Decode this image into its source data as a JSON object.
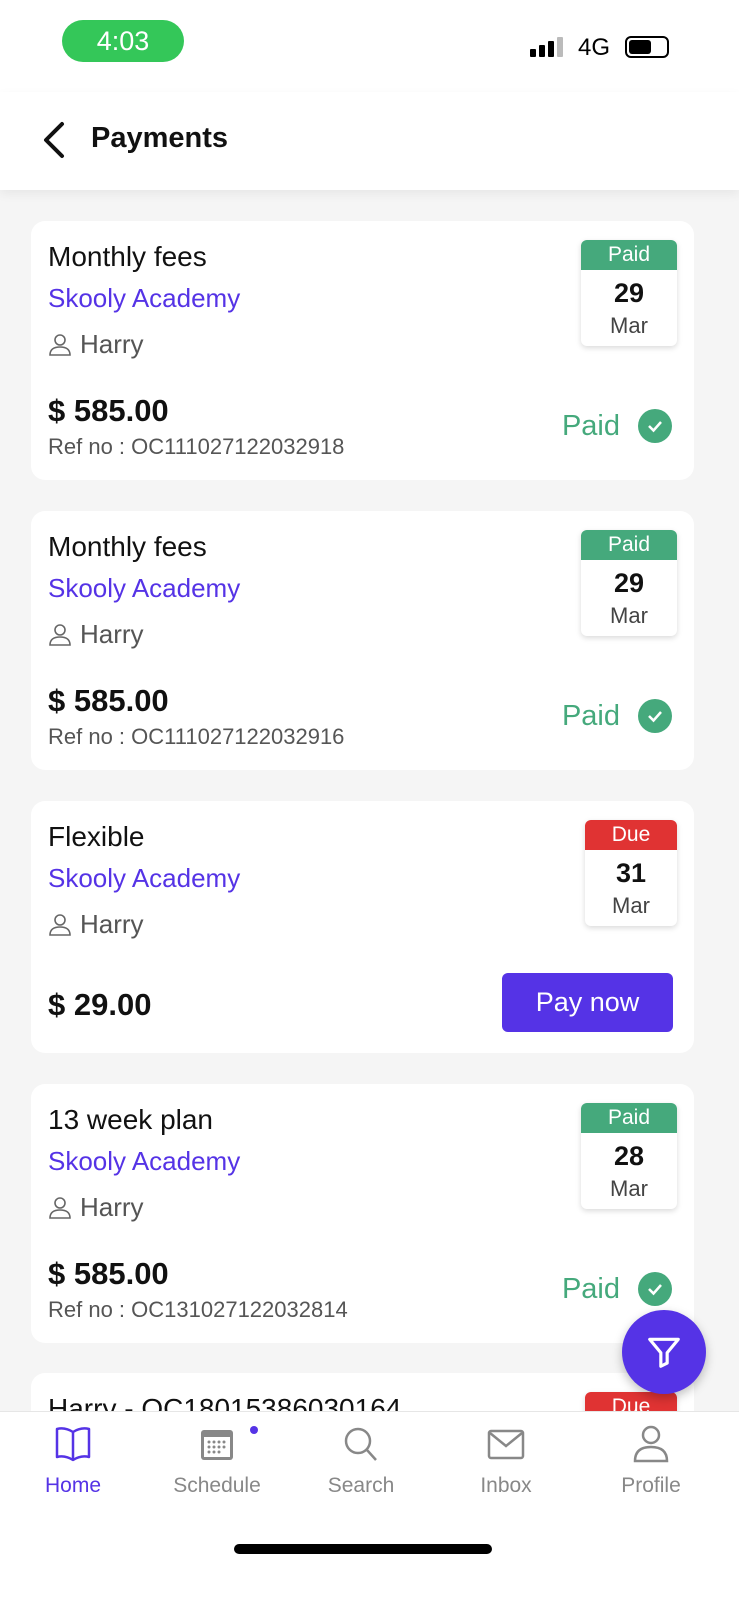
{
  "status_bar": {
    "time": "4:03",
    "network": "4G"
  },
  "header": {
    "title": "Payments"
  },
  "colors": {
    "accent": "#5533e6",
    "paid": "#45a97c",
    "due": "#e03333"
  },
  "payments": [
    {
      "title": "Monthly fees",
      "school": "Skooly Academy",
      "student": "Harry",
      "amount": "$ 585.00",
      "ref": "Ref no : OC111027122032918",
      "badge_status": "Paid",
      "day": "29",
      "month": "Mar",
      "status_label": "Paid"
    },
    {
      "title": "Monthly fees",
      "school": "Skooly Academy",
      "student": "Harry",
      "amount": "$ 585.00",
      "ref": "Ref no : OC111027122032916",
      "badge_status": "Paid",
      "day": "29",
      "month": "Mar",
      "status_label": "Paid"
    },
    {
      "title": "Flexible",
      "school": "Skooly Academy",
      "student": "Harry",
      "amount": "$ 29.00",
      "badge_status": "Due",
      "day": "31",
      "month": "Mar",
      "action_label": "Pay now"
    },
    {
      "title": "13 week plan",
      "school": "Skooly Academy",
      "student": "Harry",
      "amount": "$ 585.00",
      "ref": "Ref no : OC131027122032814",
      "badge_status": "Paid",
      "day": "28",
      "month": "Mar",
      "status_label": "Paid"
    },
    {
      "title": "Harry - OC18015386030164",
      "badge_status": "Due"
    }
  ],
  "nav": [
    {
      "label": "Home",
      "icon": "book-icon"
    },
    {
      "label": "Schedule",
      "icon": "calendar-icon"
    },
    {
      "label": "Search",
      "icon": "search-icon"
    },
    {
      "label": "Inbox",
      "icon": "mail-icon"
    },
    {
      "label": "Profile",
      "icon": "person-icon"
    }
  ]
}
